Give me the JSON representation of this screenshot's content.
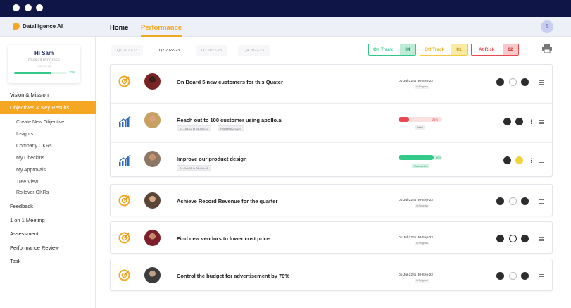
{
  "app": {
    "brand": "Datalligence AI",
    "user_initial": "S"
  },
  "nav": {
    "home": "Home",
    "performance": "Performance"
  },
  "welcome": {
    "greeting": "Hi Sam",
    "overall_label": "Overall Progress",
    "overall_sublabel": "2022-23 Q2",
    "progress_percent": 70,
    "progress_text": "70%"
  },
  "sidebar": {
    "items": [
      {
        "label": "Vision & Mission"
      },
      {
        "label": "Objectives & Key Results"
      },
      {
        "label": "Feedback"
      },
      {
        "label": "1 on 1 Meeting"
      },
      {
        "label": "Assessment"
      },
      {
        "label": "Performance Review"
      },
      {
        "label": "Task"
      }
    ],
    "subitems": [
      {
        "label": "Create New Objective"
      },
      {
        "label": "Insights"
      },
      {
        "label": "Company OKRs"
      },
      {
        "label": "My  Checkins"
      },
      {
        "label": "My Approvals"
      },
      {
        "label": "Tree View"
      },
      {
        "label": "Rollover OKRs"
      }
    ]
  },
  "quarters": [
    {
      "label": "Q1 2020-23"
    },
    {
      "label": "Q2 2022-23"
    },
    {
      "label": "Q3 2022-23"
    },
    {
      "label": "Q4 2022-23"
    }
  ],
  "status": {
    "on_track": {
      "label": "On Track",
      "count": "04",
      "color": "#32c98b"
    },
    "off_track": {
      "label": "Off Track",
      "count": "01",
      "color": "#f5c842"
    },
    "at_risk": {
      "label": "At Risk",
      "count": "02",
      "color": "#e8484e"
    }
  },
  "objectives": [
    {
      "title": "On Board 5 new customers for this Quater",
      "date": "01-Jul-22 to 30-Sep-22",
      "mini": "In Progress",
      "icon": "target-icon"
    },
    {
      "title": "Reach out to 100 customer using apollo.ai",
      "tag1": "01-Oct-22 to 31-Oct-22",
      "tag2": "Progress 2022-II",
      "progress_percent": 24,
      "progress_text": "24%",
      "chip": "Draft",
      "icon": "chart-icon"
    },
    {
      "title": "Improve our product design",
      "tag1": "01-Oct-22 to 31-Oct-22",
      "progress_percent": 80,
      "progress_text": "80%",
      "chip": "Completed",
      "icon": "chart-icon"
    },
    {
      "title": "Achieve Record Revenue for the quarter",
      "date": "01-Jul-22 to 30-Sep-22",
      "mini": "In Progress",
      "icon": "target-icon"
    },
    {
      "title": "Find new vendors to lower cost price",
      "date": "01-Jul-22 to 30-Sep-22",
      "mini": "In Progress",
      "icon": "target-icon"
    },
    {
      "title": "Control the budget for advertisement by 70%",
      "date": "01-Jul-22 to 30-Sep-22",
      "mini": "In Progress",
      "icon": "target-icon"
    }
  ]
}
